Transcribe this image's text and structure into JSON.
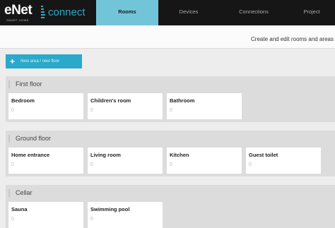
{
  "logo": {
    "brand": "eNet",
    "tagline": "SMART HOME",
    "product": "connect"
  },
  "colors": {
    "accent": "#2aa9cb",
    "active_tab": "#72c5d9",
    "topbar": "#161616"
  },
  "nav": {
    "tabs": [
      {
        "label": "Rooms",
        "active": true
      },
      {
        "label": "Devices",
        "active": false
      },
      {
        "label": "Connections",
        "active": false
      },
      {
        "label": "Project",
        "active": false
      }
    ]
  },
  "info_text": "Create and edit rooms and areas",
  "new_button": {
    "icon": "plus-icon",
    "label": "New area / new floor"
  },
  "sections": [
    {
      "name": "First floor",
      "rooms": [
        {
          "name": "Bedroom",
          "count": "0"
        },
        {
          "name": "Children's room",
          "count": "0"
        },
        {
          "name": "Bathroom",
          "count": "0"
        }
      ]
    },
    {
      "name": "Ground floor",
      "rooms": [
        {
          "name": "Home entrance",
          "count": "0"
        },
        {
          "name": "Living room",
          "count": "0"
        },
        {
          "name": "Kitchen",
          "count": "0"
        },
        {
          "name": "Guest toilet",
          "count": "0"
        }
      ]
    },
    {
      "name": "Cellar",
      "rooms": [
        {
          "name": "Sauna",
          "count": "0"
        },
        {
          "name": "Swimming pool",
          "count": "0"
        }
      ]
    }
  ]
}
